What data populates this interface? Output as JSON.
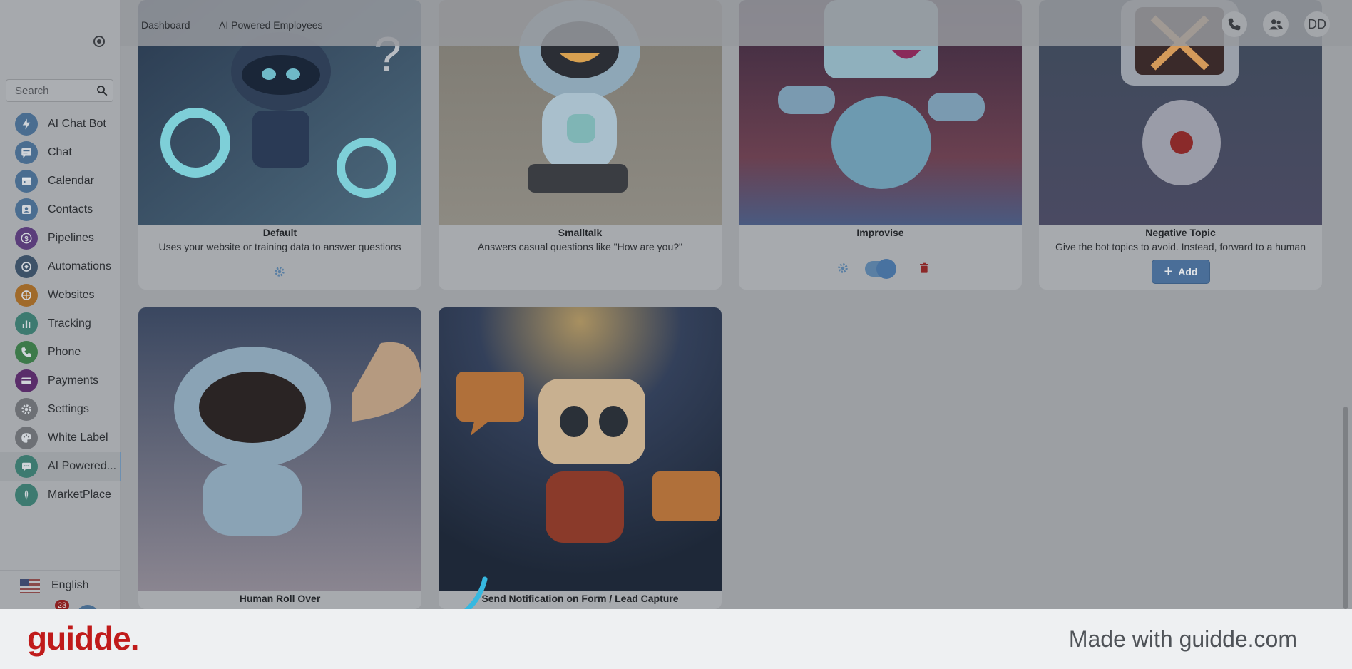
{
  "topbar": {
    "breadcrumbs": [
      "Dashboard",
      "AI Powered Employees"
    ],
    "avatar_initials": "DD"
  },
  "sidebar": {
    "search_placeholder": "Search",
    "items": [
      {
        "label": "AI Chat Bot",
        "icon": "lightning-icon",
        "color": "#4a6d90"
      },
      {
        "label": "Chat",
        "icon": "chat-icon",
        "color": "#4a6d90"
      },
      {
        "label": "Calendar",
        "icon": "calendar-icon",
        "color": "#4a6d90"
      },
      {
        "label": "Contacts",
        "icon": "contacts-icon",
        "color": "#4a6d90"
      },
      {
        "label": "Pipelines",
        "icon": "dollar-icon",
        "color": "#5a3d7a"
      },
      {
        "label": "Automations",
        "icon": "automation-icon",
        "color": "#3d5268"
      },
      {
        "label": "Websites",
        "icon": "website-icon",
        "color": "#a06a2a"
      },
      {
        "label": "Tracking",
        "icon": "chart-icon",
        "color": "#3d7a70"
      },
      {
        "label": "Phone",
        "icon": "phone-icon",
        "color": "#3d7a4a"
      },
      {
        "label": "Payments",
        "icon": "card-icon",
        "color": "#5a2d6a"
      },
      {
        "label": "Settings",
        "icon": "gear-icon",
        "color": "#6d7075"
      },
      {
        "label": "White Label",
        "icon": "palette-icon",
        "color": "#6d7075"
      },
      {
        "label": "AI Powered...",
        "icon": "ai-chat-icon",
        "color": "#3d7a70"
      },
      {
        "label": "MarketPlace",
        "icon": "marketplace-icon",
        "color": "#3d7a70"
      }
    ],
    "language": "English",
    "notification_count": "23"
  },
  "cards": [
    {
      "title": "Default",
      "description": "Uses your website or training data to answer questions"
    },
    {
      "title": "Smalltalk",
      "description": "Answers casual questions like \"How are you?\""
    },
    {
      "title": "Improvise",
      "description": ""
    },
    {
      "title": "Negative Topic",
      "description": "Give the bot topics to avoid. Instead, forward to a human",
      "add_label": "Add"
    },
    {
      "title": "Human Roll Over",
      "description": ""
    },
    {
      "title": "Send Notification on Form / Lead Capture",
      "description": ""
    }
  ],
  "footer": {
    "logo": "guidde.",
    "tagline": "Made with guidde.com"
  }
}
